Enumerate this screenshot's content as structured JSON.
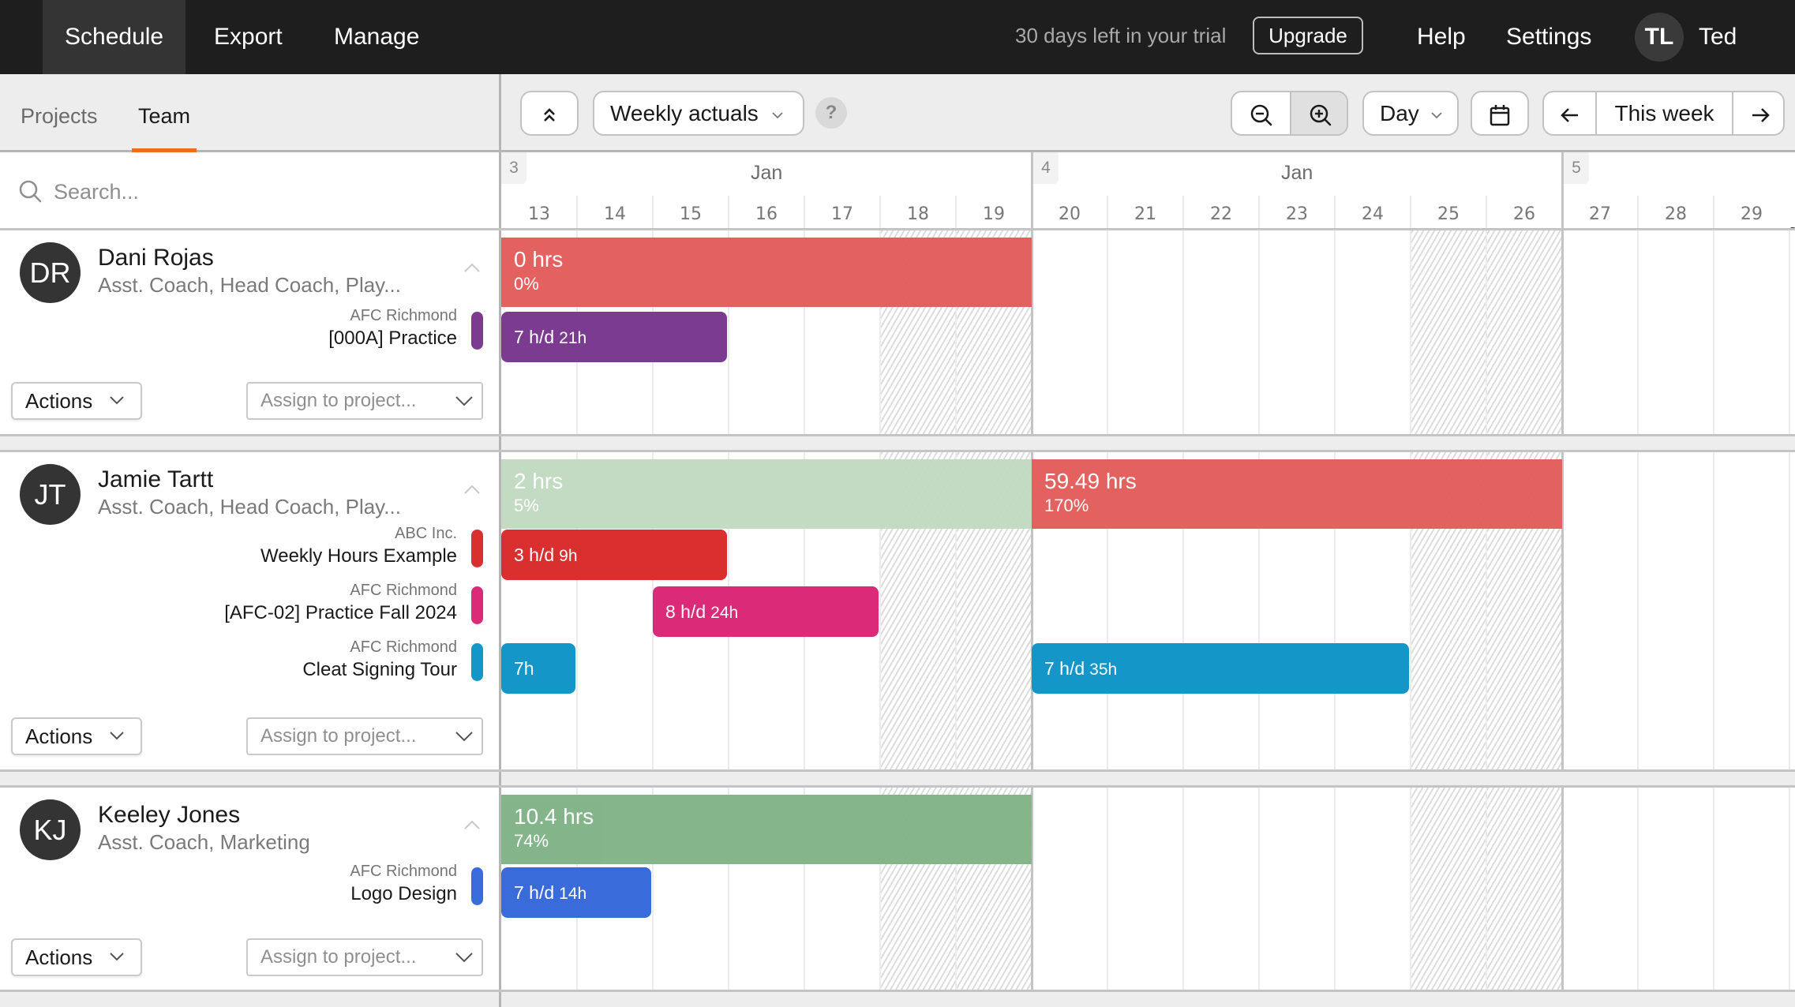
{
  "nav": {
    "tabs": [
      {
        "label": "Schedule",
        "active": true
      },
      {
        "label": "Export",
        "active": false
      },
      {
        "label": "Manage",
        "active": false
      }
    ],
    "trial_text": "30 days left in your trial",
    "upgrade_label": "Upgrade",
    "help_label": "Help",
    "settings_label": "Settings",
    "user_initials": "TL",
    "user_name": "Ted"
  },
  "left": {
    "tabs": [
      {
        "label": "Projects",
        "active": false
      },
      {
        "label": "Team",
        "active": true
      }
    ],
    "search_placeholder": "Search..."
  },
  "toolbar": {
    "collapse_all_icon": "double-chevron-up-icon",
    "view_select": "Weekly actuals",
    "help_label": "?",
    "zoom_out_icon": "zoom-out-icon",
    "zoom_in_icon": "zoom-in-icon",
    "scale_select": "Day",
    "calendar_icon": "calendar-icon",
    "prev_icon": "arrow-left-icon",
    "this_week_label": "This week",
    "next_icon": "arrow-right-icon"
  },
  "timeline": {
    "weeks": [
      {
        "number": "3",
        "month": "Jan"
      },
      {
        "number": "4",
        "month": "Jan"
      },
      {
        "number": "5",
        "month": ""
      }
    ],
    "days": [
      "13",
      "14",
      "15",
      "16",
      "17",
      "18",
      "19",
      "20",
      "21",
      "22",
      "23",
      "24",
      "25",
      "26",
      "27",
      "28",
      "29"
    ],
    "weekend_days": [
      "18",
      "19",
      "25",
      "26"
    ]
  },
  "people": [
    {
      "initials": "DR",
      "name": "Dani Rojas",
      "roles": "Asst. Coach, Head Coach, Play...",
      "actions_label": "Actions",
      "assign_placeholder": "Assign to project...",
      "summaries": [
        {
          "hours": "0 hrs",
          "percent": "0%",
          "status": "over",
          "color": "#e25c5a",
          "start_day": "13",
          "end_day": "19"
        }
      ],
      "projects": [
        {
          "client": "AFC Richmond",
          "name": "[000A] Practice",
          "color": "#7b3b91",
          "allocations": [
            {
              "rate": "7 h/d",
              "total": "21h",
              "start_day": "13",
              "end_day": "15"
            }
          ]
        }
      ]
    },
    {
      "initials": "JT",
      "name": "Jamie Tartt",
      "roles": "Asst. Coach, Head Coach, Play...",
      "actions_label": "Actions",
      "assign_placeholder": "Assign to project...",
      "summaries": [
        {
          "hours": "2 hrs",
          "percent": "5%",
          "status": "under",
          "color": "#c1d9c1",
          "start_day": "13",
          "end_day": "19"
        },
        {
          "hours": "59.49 hrs",
          "percent": "170%",
          "status": "over",
          "color": "#e25c5a",
          "start_day": "20",
          "end_day": "26"
        }
      ],
      "projects": [
        {
          "client": "ABC Inc.",
          "name": "Weekly Hours Example",
          "color": "#d92f2f",
          "allocations": [
            {
              "rate": "3 h/d",
              "total": "9h",
              "start_day": "13",
              "end_day": "15"
            }
          ]
        },
        {
          "client": "AFC Richmond",
          "name": "[AFC-02] Practice Fall 2024",
          "color": "#db2a77",
          "allocations": [
            {
              "rate": "8 h/d",
              "total": "24h",
              "start_day": "15",
              "end_day": "17"
            }
          ]
        },
        {
          "client": "AFC Richmond",
          "name": "Cleat Signing Tour",
          "color": "#1596c9",
          "allocations": [
            {
              "rate": "7h",
              "total": "",
              "start_day": "13",
              "end_day": "13"
            },
            {
              "rate": "7 h/d",
              "total": "35h",
              "start_day": "20",
              "end_day": "24"
            }
          ]
        }
      ]
    },
    {
      "initials": "KJ",
      "name": "Keeley Jones",
      "roles": "Asst. Coach, Marketing",
      "actions_label": "Actions",
      "assign_placeholder": "Assign to project...",
      "summaries": [
        {
          "hours": "10.4 hrs",
          "percent": "74%",
          "status": "ok",
          "color": "#80b386",
          "start_day": "13",
          "end_day": "19"
        }
      ],
      "projects": [
        {
          "client": "AFC Richmond",
          "name": "Logo Design",
          "color": "#3a6bdb",
          "allocations": [
            {
              "rate": "7 h/d",
              "total": "14h",
              "start_day": "13",
              "end_day": "14"
            }
          ]
        }
      ]
    }
  ]
}
